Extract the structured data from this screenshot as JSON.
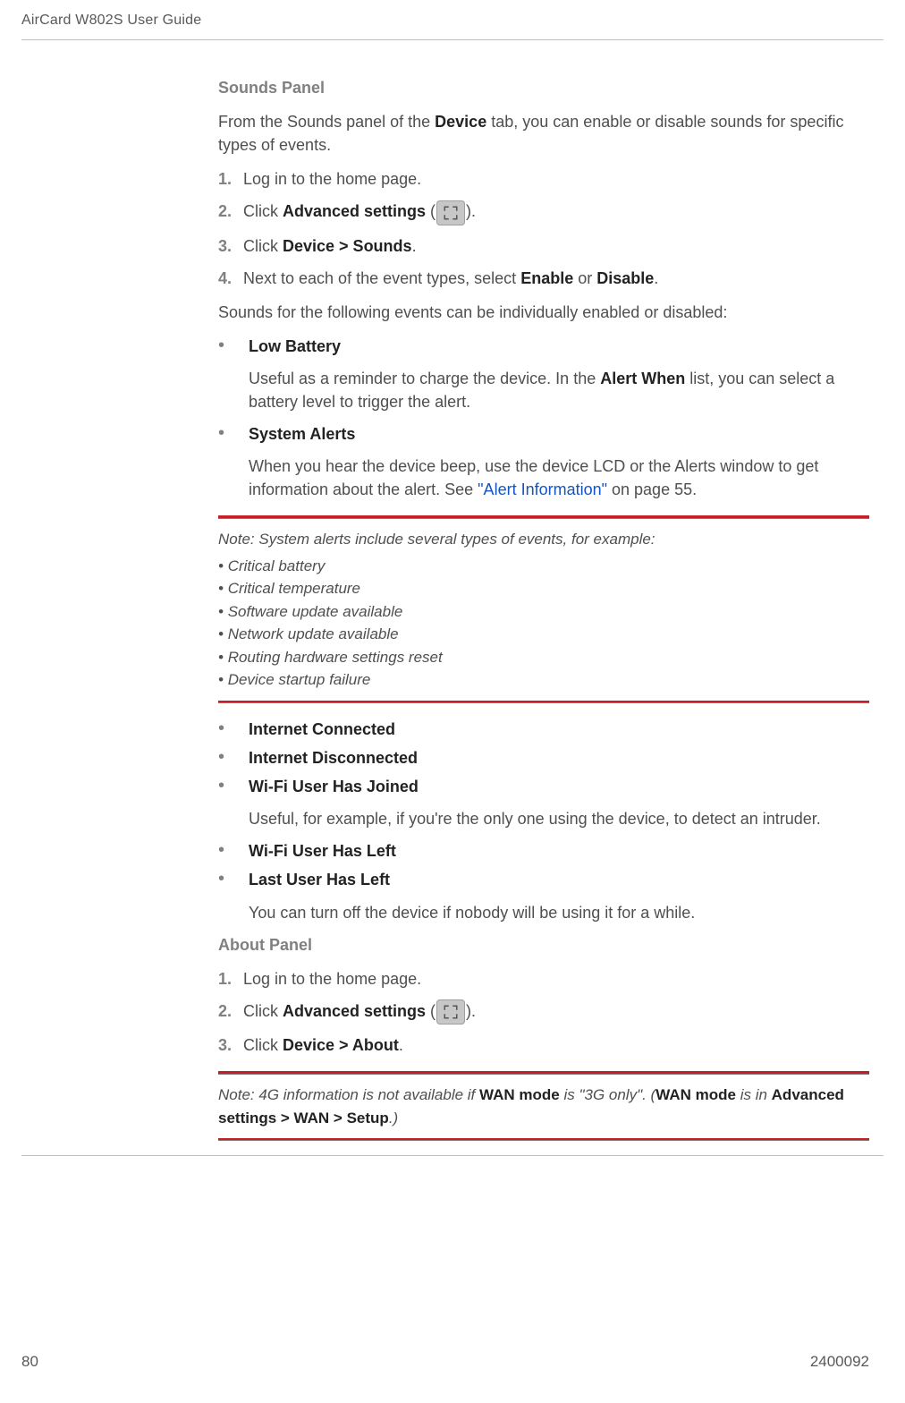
{
  "header": {
    "running_title": "AirCard W802S User Guide"
  },
  "sections": {
    "sounds": {
      "heading": "Sounds Panel",
      "intro_1": "From the Sounds panel of the ",
      "intro_bold_device": "Device",
      "intro_2": " tab, you can enable or disable sounds for specific types of events.",
      "steps_num": [
        "1.",
        "2.",
        "3.",
        "4."
      ],
      "step1": "Log in to the home page.",
      "step2_pre": "Click ",
      "step2_bold": "Advanced settings",
      "step2_post": " (",
      "step2_close": ").",
      "step3_pre": "Click ",
      "step3_bold": "Device > Sounds",
      "step3_post": ".",
      "step4_pre": "Next to each of the event types, select ",
      "step4_bold_enable": "Enable",
      "step4_mid": " or ",
      "step4_bold_disable": "Disable",
      "step4_post": ".",
      "followup": "Sounds for the following events can be individually enabled or disabled:",
      "bullets": {
        "low_battery": "Low Battery",
        "low_battery_desc_pre": "Useful as a reminder to charge the device. In the ",
        "low_battery_desc_bold": "Alert When",
        "low_battery_desc_post": " list, you can select a battery level to trigger the alert.",
        "system_alerts": "System Alerts",
        "system_alerts_desc_pre": "When you hear the device beep, use the device LCD or the Alerts window to get information about the alert. See ",
        "system_alerts_link": "\"Alert Information\"",
        "system_alerts_desc_post": " on page 55.",
        "internet_connected": "Internet Connected",
        "internet_disconnected": "Internet Disconnected",
        "wifi_joined": "Wi-Fi User Has Joined",
        "wifi_joined_desc": "Useful, for example, if you're the only one using the device, to detect an intruder.",
        "wifi_left": "Wi-Fi User Has Left",
        "last_user_left": "Last User Has Left",
        "last_user_left_desc": "You can turn off the device if nobody will be using it for a while."
      },
      "note": {
        "lead": "Note:",
        "text": "System alerts include several types of events, for example:",
        "items": [
          "Critical battery",
          "Critical temperature",
          "Software update available",
          "Network update available",
          "Routing hardware settings reset",
          "Device startup failure"
        ]
      }
    },
    "about": {
      "heading": "About Panel",
      "steps_num": [
        "1.",
        "2.",
        "3."
      ],
      "step1": "Log in to the home page.",
      "step2_pre": "Click ",
      "step2_bold": "Advanced settings",
      "step2_post": " (",
      "step2_close": ").",
      "step3_pre": "Click ",
      "step3_bold": "Device > About",
      "step3_post": ".",
      "note": {
        "lead": "Note:",
        "pre": "4G information is not available if ",
        "bold1": "WAN mode",
        "mid1": " is \"3G only\". (",
        "bold2": "WAN mode",
        "mid2": " is in ",
        "bold3": "Advanced settings > WAN > Setup",
        "post": ".)"
      }
    }
  },
  "footer": {
    "page_number": "80",
    "doc_id": "2400092"
  }
}
